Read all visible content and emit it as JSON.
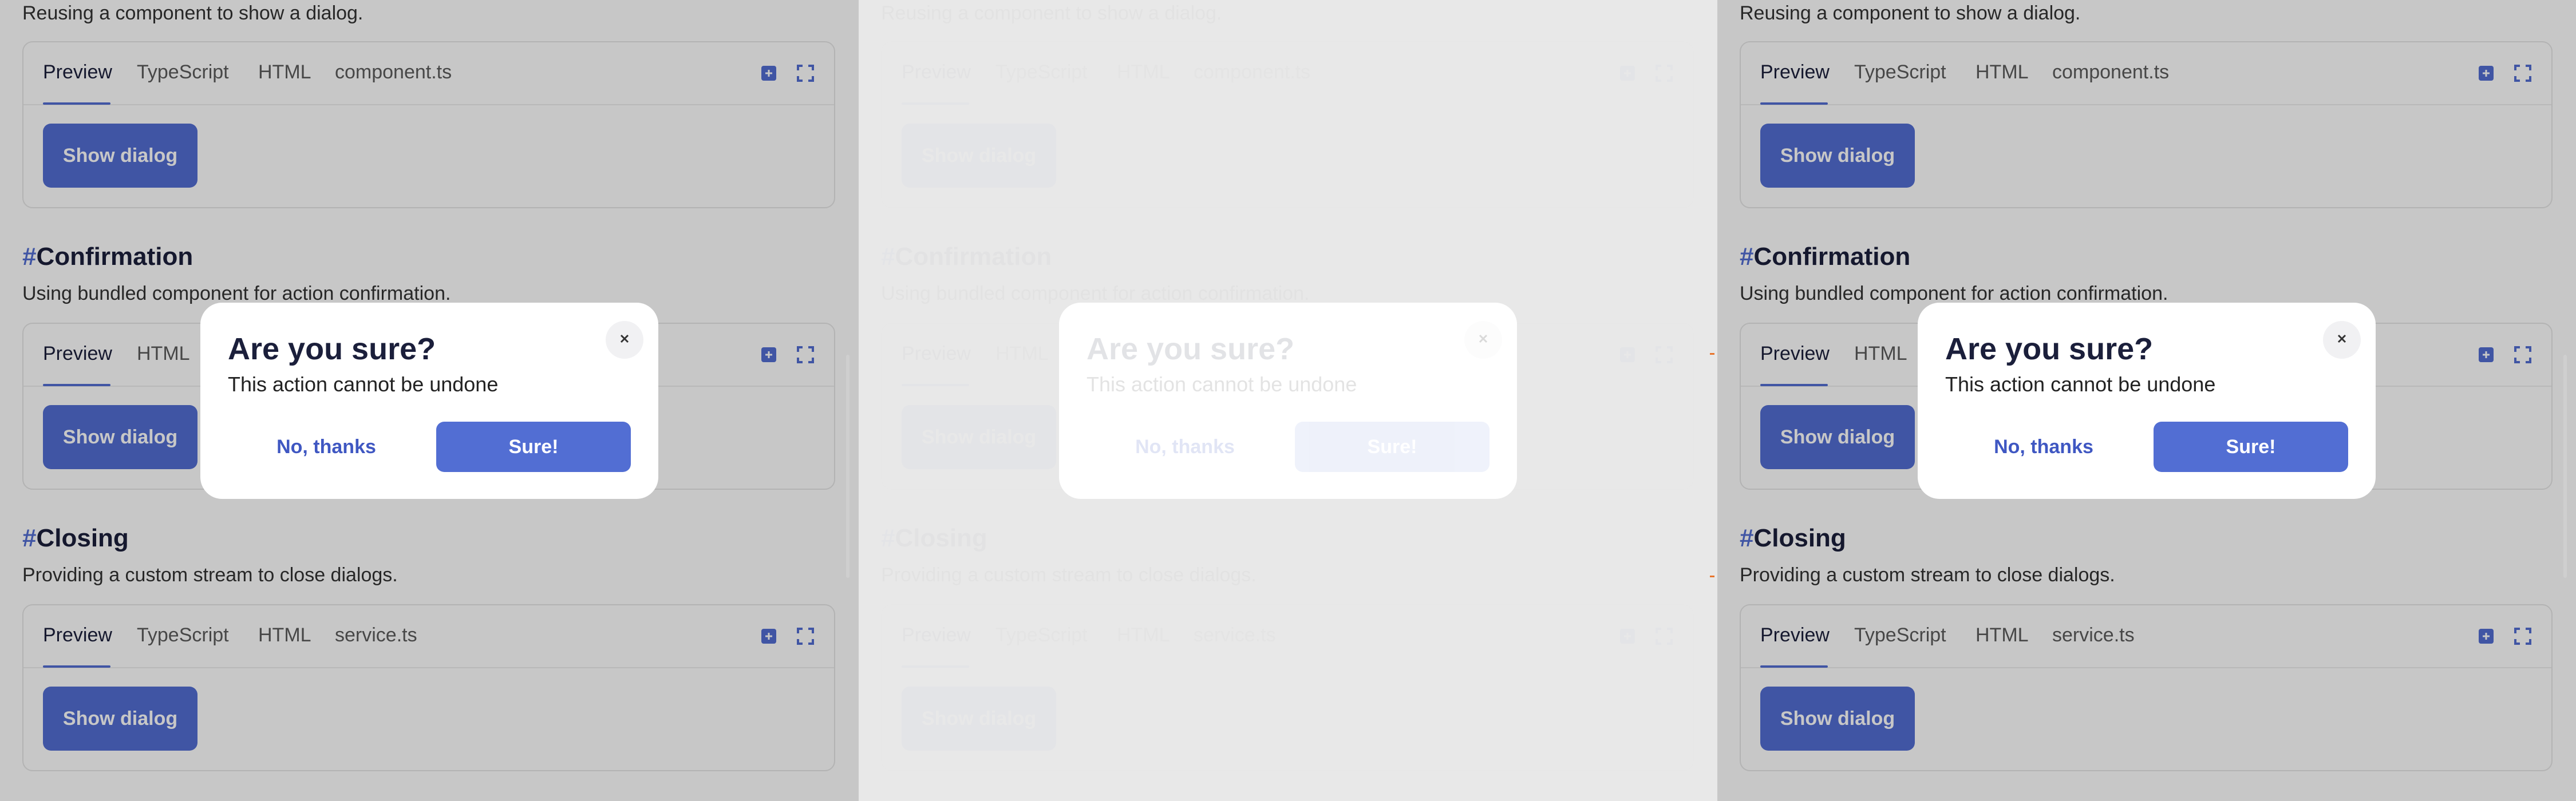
{
  "sections": {
    "dialog_component": {
      "description": "Reusing a component to show a dialog.",
      "tabs": [
        "Preview",
        "TypeScript",
        "HTML",
        "component.ts"
      ],
      "button": "Show dialog"
    },
    "confirmation": {
      "hash": "#",
      "title": "Confirmation",
      "description": "Using bundled component for action confirmation.",
      "tabs": [
        "Preview",
        "HTML"
      ],
      "button": "Show dialog"
    },
    "closing": {
      "hash": "#",
      "title": "Closing",
      "description": "Providing a custom stream to close dialogs.",
      "tabs": [
        "Preview",
        "TypeScript",
        "HTML",
        "service.ts"
      ],
      "button": "Show dialog"
    }
  },
  "dialog": {
    "title": "Are you sure?",
    "message": "This action cannot be undone",
    "cancel_label": "No, thanks",
    "confirm_label": "Sure!"
  },
  "icons": {
    "close": "close-icon",
    "fullscreen": "fullscreen-icon",
    "open_in_editor": "open-in-editor-icon"
  },
  "colors": {
    "accent": "#526ed3",
    "heading": "#1b1f3b",
    "marker": "#e8742c"
  }
}
